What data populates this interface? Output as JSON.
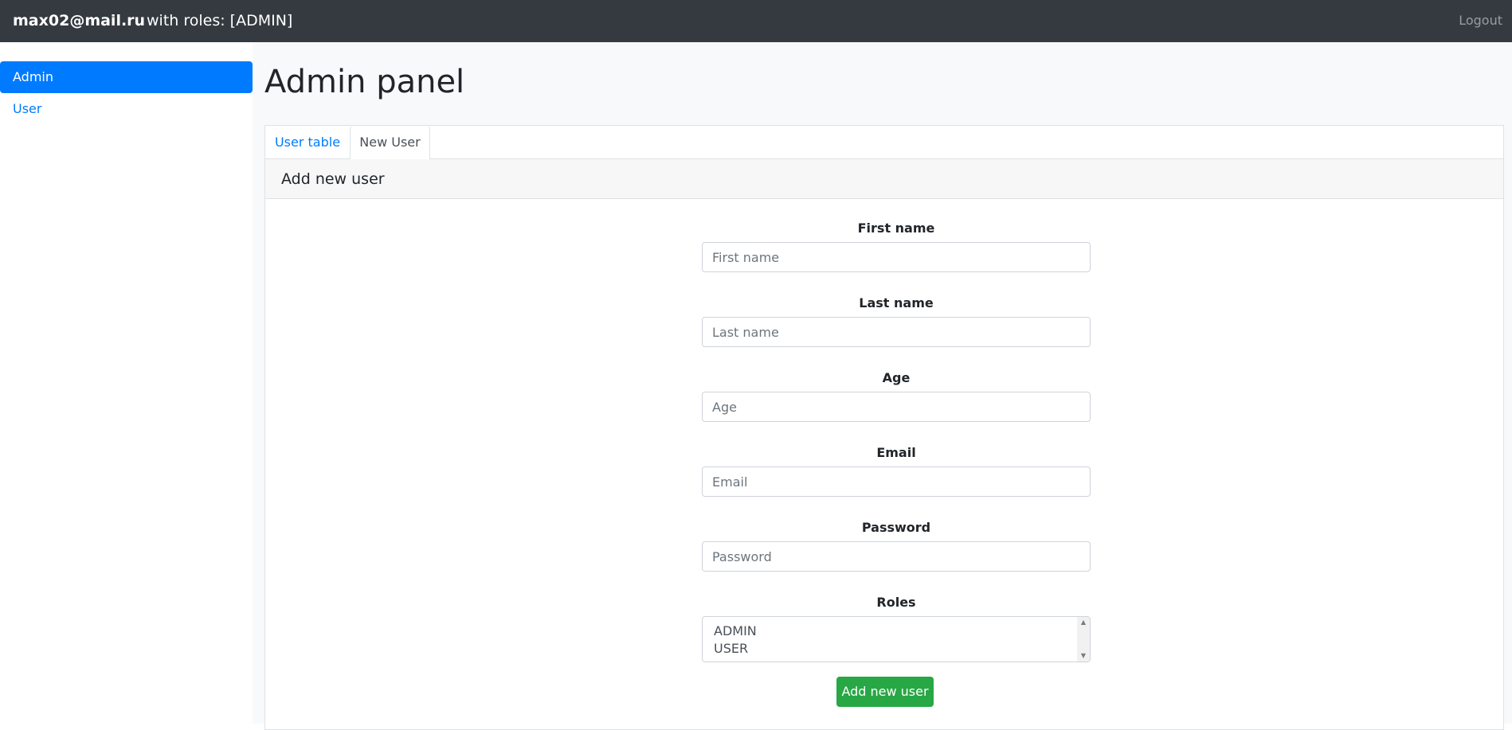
{
  "header": {
    "email": "max02@mail.ru",
    "roles_text": "with roles: [ADMIN]",
    "logout_label": "Logout"
  },
  "sidebar": {
    "items": [
      {
        "label": "Admin",
        "active": true
      },
      {
        "label": "User",
        "active": false
      }
    ]
  },
  "main": {
    "title": "Admin panel",
    "tabs": [
      {
        "label": "User table",
        "active": false
      },
      {
        "label": "New User",
        "active": true
      }
    ],
    "section_title": "Add new user",
    "form": {
      "fields": [
        {
          "label": "First name",
          "placeholder": "First name",
          "value": ""
        },
        {
          "label": "Last name",
          "placeholder": "Last name",
          "value": ""
        },
        {
          "label": "Age",
          "placeholder": "Age",
          "value": ""
        },
        {
          "label": "Email",
          "placeholder": "Email",
          "value": ""
        },
        {
          "label": "Password",
          "placeholder": "Password",
          "value": ""
        }
      ],
      "roles_label": "Roles",
      "roles_options": [
        "ADMIN",
        "USER"
      ],
      "submit_label": "Add new user"
    }
  },
  "colors": {
    "navbar": "#343a40",
    "primary": "#007bff",
    "success": "#28a745",
    "page_bg": "#f8f9fa"
  },
  "icons": {
    "scroll_up": "scroll-up-arrow-icon",
    "scroll_down": "scroll-down-arrow-icon"
  }
}
